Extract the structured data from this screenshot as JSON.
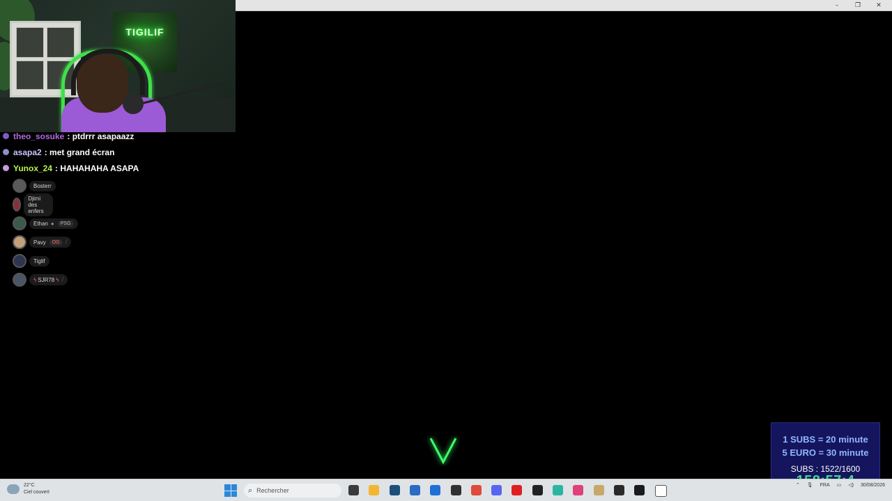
{
  "webcam": {
    "neon_sign": "TIGILIF"
  },
  "chat": [
    {
      "user": "theo_sosuke",
      "user_color": "#b06ae0",
      "icon_color": "#7d5cc4",
      "message": "ptdrrr asapaazz"
    },
    {
      "user": "asapa2",
      "user_color": "#c9c3ff",
      "icon_color": "#8e8ec8",
      "message": "met grand écran"
    },
    {
      "user": "Yunox_24",
      "user_color": "#b7f54a",
      "icon_color": "#c99ae0",
      "message": "HAHAHAHA ASAPA"
    }
  ],
  "voice": [
    {
      "name": "Bosterr",
      "avatar_color": "#5a5a5a",
      "tag": ""
    },
    {
      "name": "Djimi des enfers",
      "avatar_color": "#8a2f3a",
      "tag": ""
    },
    {
      "name": "Ethan",
      "avatar_color": "#3c5a4a",
      "tag": "PSG"
    },
    {
      "name": "Pavy",
      "avatar_color": "#c4a07a",
      "tag": "OG"
    },
    {
      "name": "Tiglif",
      "avatar_color": "#2d3550",
      "tag": ""
    },
    {
      "name": "SJR78",
      "avatar_color": "#4a5566",
      "tag": ""
    }
  ],
  "subathon": {
    "line1": "1 SUBS = 20 minute",
    "line2": "5 EURO = 30 minute",
    "subs_label": "SUBS : 1522/1600",
    "timer": "158:57:4"
  },
  "taskbar": {
    "weather_temp": "22°C",
    "weather_desc": "Ciel couvert",
    "search_placeholder": "Rechercher",
    "language": "FRA",
    "date": "30/08/2026",
    "apps": [
      {
        "name": "file-explorer-dark-icon",
        "color": "#3a3a3a"
      },
      {
        "name": "folder-icon",
        "color": "#f2b632"
      },
      {
        "name": "steam-icon",
        "color": "#1b4f7a"
      },
      {
        "name": "store-icon",
        "color": "#2a6bc4"
      },
      {
        "name": "mail-icon",
        "color": "#1f6fd6"
      },
      {
        "name": "obs-icon",
        "color": "#303030"
      },
      {
        "name": "chrome-icon",
        "color": "#e04a3a"
      },
      {
        "name": "discord-icon",
        "color": "#5865f2"
      },
      {
        "name": "youtube-icon",
        "color": "#e02020"
      },
      {
        "name": "tiktok-icon",
        "color": "#222222"
      },
      {
        "name": "audio-icon",
        "color": "#2bb5a0"
      },
      {
        "name": "camera-app-icon",
        "color": "#e0407a"
      },
      {
        "name": "map-icon",
        "color": "#c8a86a"
      },
      {
        "name": "epic-games-icon",
        "color": "#2a2a2a"
      },
      {
        "name": "adobe-icon",
        "color": "#1a1a1a"
      },
      {
        "name": "capcut-icon",
        "color": "#ffffff"
      }
    ]
  }
}
